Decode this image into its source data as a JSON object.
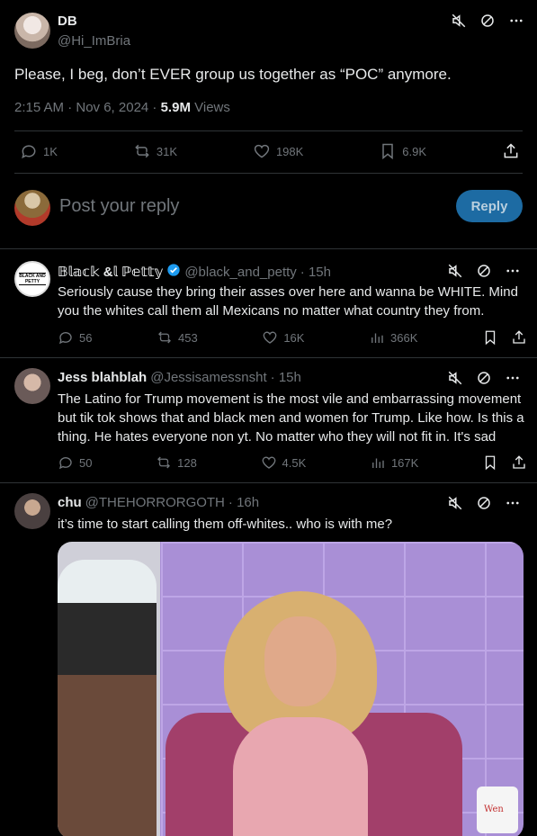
{
  "main_tweet": {
    "name": "DB",
    "handle": "@Hi_ImBria",
    "text": "Please, I beg, don’t EVER group us together as “POC” anymore.",
    "time": "2:15 AM · Nov 6, 2024 ·",
    "views_count": "5.9M",
    "views_label": "Views",
    "replies": "1K",
    "reposts": "31K",
    "likes": "198K",
    "bookmarks": "6.9K"
  },
  "composer": {
    "placeholder": "Post your reply",
    "button": "Reply"
  },
  "replies": [
    {
      "name": "𝔹𝕝𝕒𝕔𝕜 &𝕝 ℙ𝕖𝕥𝕥𝕪",
      "handle": "@black_and_petty",
      "time": "· 15h",
      "avatar_text": "BLACK AND PETTY",
      "text": "Seriously cause they bring their asses over here and wanna be WHITE. Mind you the whites call them all Mexicans no matter what country they from.",
      "replies": "56",
      "reposts": "453",
      "likes": "16K",
      "views": "366K"
    },
    {
      "name": "Jess blahblah",
      "handle": "@Jessisamessnsht",
      "time": "· 15h",
      "text": "The Latino for Trump movement is the most vile and embarrassing movement but tik tok shows that and black men and women for Trump. Like how. Is this a thing. He hates everyone non yt. No matter who they will not fit in. It's sad",
      "replies": "50",
      "reposts": "128",
      "likes": "4.5K",
      "views": "167K"
    },
    {
      "name": "chu",
      "handle": "@THEHORRORGOTH",
      "time": "· 16h",
      "text": "it’s time to start calling them off-whites.. who is with me?",
      "media_mug_text": "Wen"
    }
  ],
  "colors": {
    "background": "#000000",
    "text": "#e7e9ea",
    "muted": "#71767b",
    "divider": "#2f3336",
    "reply_button": "#1d6ba3",
    "verified": "#1d9bf0"
  }
}
